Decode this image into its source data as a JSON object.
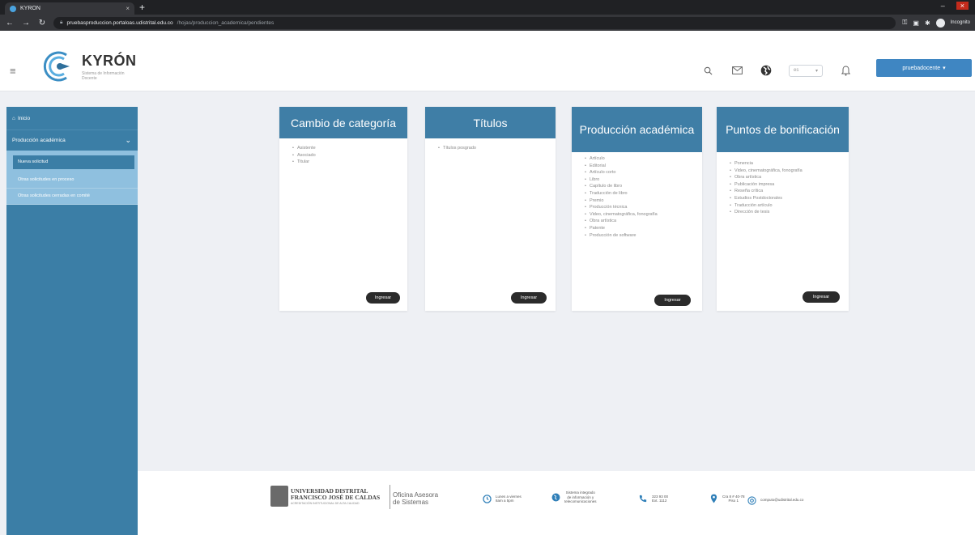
{
  "browser": {
    "tab_title": "KYRON",
    "url_host": "pruebasproduccion.portaloas.udistrital.edu.co",
    "url_path": "/hojas/produccion_academica/pendientes",
    "incognito_label": "Incognito"
  },
  "header": {
    "brand_name": "KYRÓN",
    "brand_subtitle": "Sistema de Información Docente",
    "language_value": "es",
    "user_label": "pruebadocente"
  },
  "sidebar": {
    "home_label": "Inicio",
    "group_label": "Producción académica",
    "items": [
      {
        "label": "Nueva solicitud"
      },
      {
        "label": "Otras solicitudes en proceso"
      },
      {
        "label": "Otras solicitudes cerradas en comité"
      }
    ]
  },
  "cards": [
    {
      "title": "Cambio de categoría",
      "items": [
        "Asistente",
        "Asociado",
        "Titular"
      ],
      "button": "Ingresar"
    },
    {
      "title": "Títulos",
      "items": [
        "Títulos posgrado"
      ],
      "button": "Ingresar"
    },
    {
      "title": "Producción académica",
      "items": [
        "Artículo",
        "Editorial",
        "Artículo corto",
        "Libro",
        "Capítulo de libro",
        "Traducción de libro",
        "Premio",
        "Producción técnica",
        "Video, cinematográfica, fonografía",
        "Obra artística",
        "Patente",
        "Producción de software"
      ],
      "button": "Ingresar"
    },
    {
      "title": "Puntos de bonificación",
      "items": [
        "Ponencia",
        "Video, cinematográfica, fonografía",
        "Obra artística",
        "Publicación impresa",
        "Reseña crítica",
        "Estudios Postdoctorales",
        "Traducción artículo",
        "Dirección de tesis"
      ],
      "button": "Ingresar"
    }
  ],
  "footer": {
    "university_line1": "UNIVERSIDAD DISTRITAL",
    "university_line2": "FRANCISCO JOSÉ DE CALDAS",
    "university_tagline": "ACREDITACIÓN INSTITUCIONAL DE ALTA CALIDAD",
    "office_line1": "Oficina Asesora",
    "office_line2": "de Sistemas",
    "hours_line1": "Lunes a viernes",
    "hours_line2": "8am a 5pm",
    "system_line1": "Sistema integrado",
    "system_line2": "de información y",
    "system_line3": "telecomunicaciones",
    "phone_line1": "323 93 00",
    "phone_line2": "Ext. 1112",
    "address_line1": "Cra 8 # 40-78",
    "address_line2": "Piso 1",
    "email": "computo@udistrital.edu.co"
  },
  "colors": {
    "accent": "#3f7ea6",
    "user_button": "#3f86c2",
    "sidebar": "#3b7ea6",
    "sidebar_sub": "#8fc0df",
    "background": "#eef0f4"
  }
}
